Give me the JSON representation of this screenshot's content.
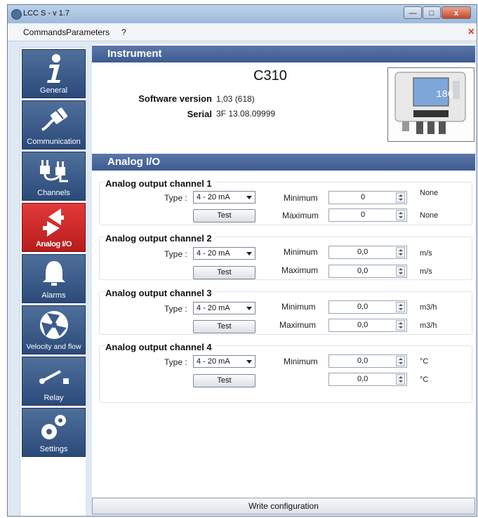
{
  "window": {
    "title": "LCC S - v 1.7",
    "min": "—",
    "max": "□",
    "close": "x"
  },
  "menu": {
    "items": [
      "Commands",
      "Parameters",
      "?"
    ],
    "close_icon": "×"
  },
  "sidebar": {
    "items": [
      {
        "label": "General",
        "icon": "info-icon",
        "active": false
      },
      {
        "label": "Communication",
        "icon": "ethernet-plug-icon",
        "active": false
      },
      {
        "label": "Channels",
        "icon": "power-plugs-icon",
        "active": false
      },
      {
        "label": "Analog I/O",
        "icon": "arrows-icon",
        "active": true
      },
      {
        "label": "Alarms",
        "icon": "bell-icon",
        "active": false
      },
      {
        "label": "Velocity and flow",
        "icon": "fan-icon",
        "active": false
      },
      {
        "label": "Relay",
        "icon": "switch-icon",
        "active": false
      },
      {
        "label": "Settings",
        "icon": "gears-icon",
        "active": false
      }
    ]
  },
  "instrument": {
    "heading": "Instrument",
    "name": "C310",
    "software_label": "Software version",
    "software_value": "1,03 (618)",
    "serial_label": "Serial",
    "serial_value": "3F 13.08.09999",
    "device_display": "180"
  },
  "analog": {
    "heading": "Analog I/O",
    "type_label": "Type :",
    "test_label": "Test",
    "channels": [
      {
        "title": "Analog output channel 1",
        "type": "4 - 20 mA",
        "min_label": "Minimum",
        "min": "0",
        "min_unit": "None",
        "max_label": "Maximum",
        "max": "0",
        "max_unit": "None"
      },
      {
        "title": "Analog output channel 2",
        "type": "4 - 20 mA",
        "min_label": "Minimum",
        "min": "0,0",
        "min_unit": "m/s",
        "max_label": "Maximum",
        "max": "0,0",
        "max_unit": "m/s"
      },
      {
        "title": "Analog output channel 3",
        "type": "4 - 20 mA",
        "min_label": "Minimum",
        "min": "0,0",
        "min_unit": "m3/h",
        "max_label": "Maximum",
        "max": "0,0",
        "max_unit": "m3/h"
      },
      {
        "title": "Analog output channel 4",
        "type": "4 - 20 mA",
        "min_label": "Minimum",
        "min": "0,0",
        "min_unit": "°C",
        "max_label": "",
        "max": "0,0",
        "max_unit": "°C"
      }
    ]
  },
  "footer": {
    "write_label": "Write configuration"
  },
  "colors": {
    "nav": "#3d5b8c",
    "nav_active": "#d12a2a",
    "header": "#4a67a0"
  }
}
